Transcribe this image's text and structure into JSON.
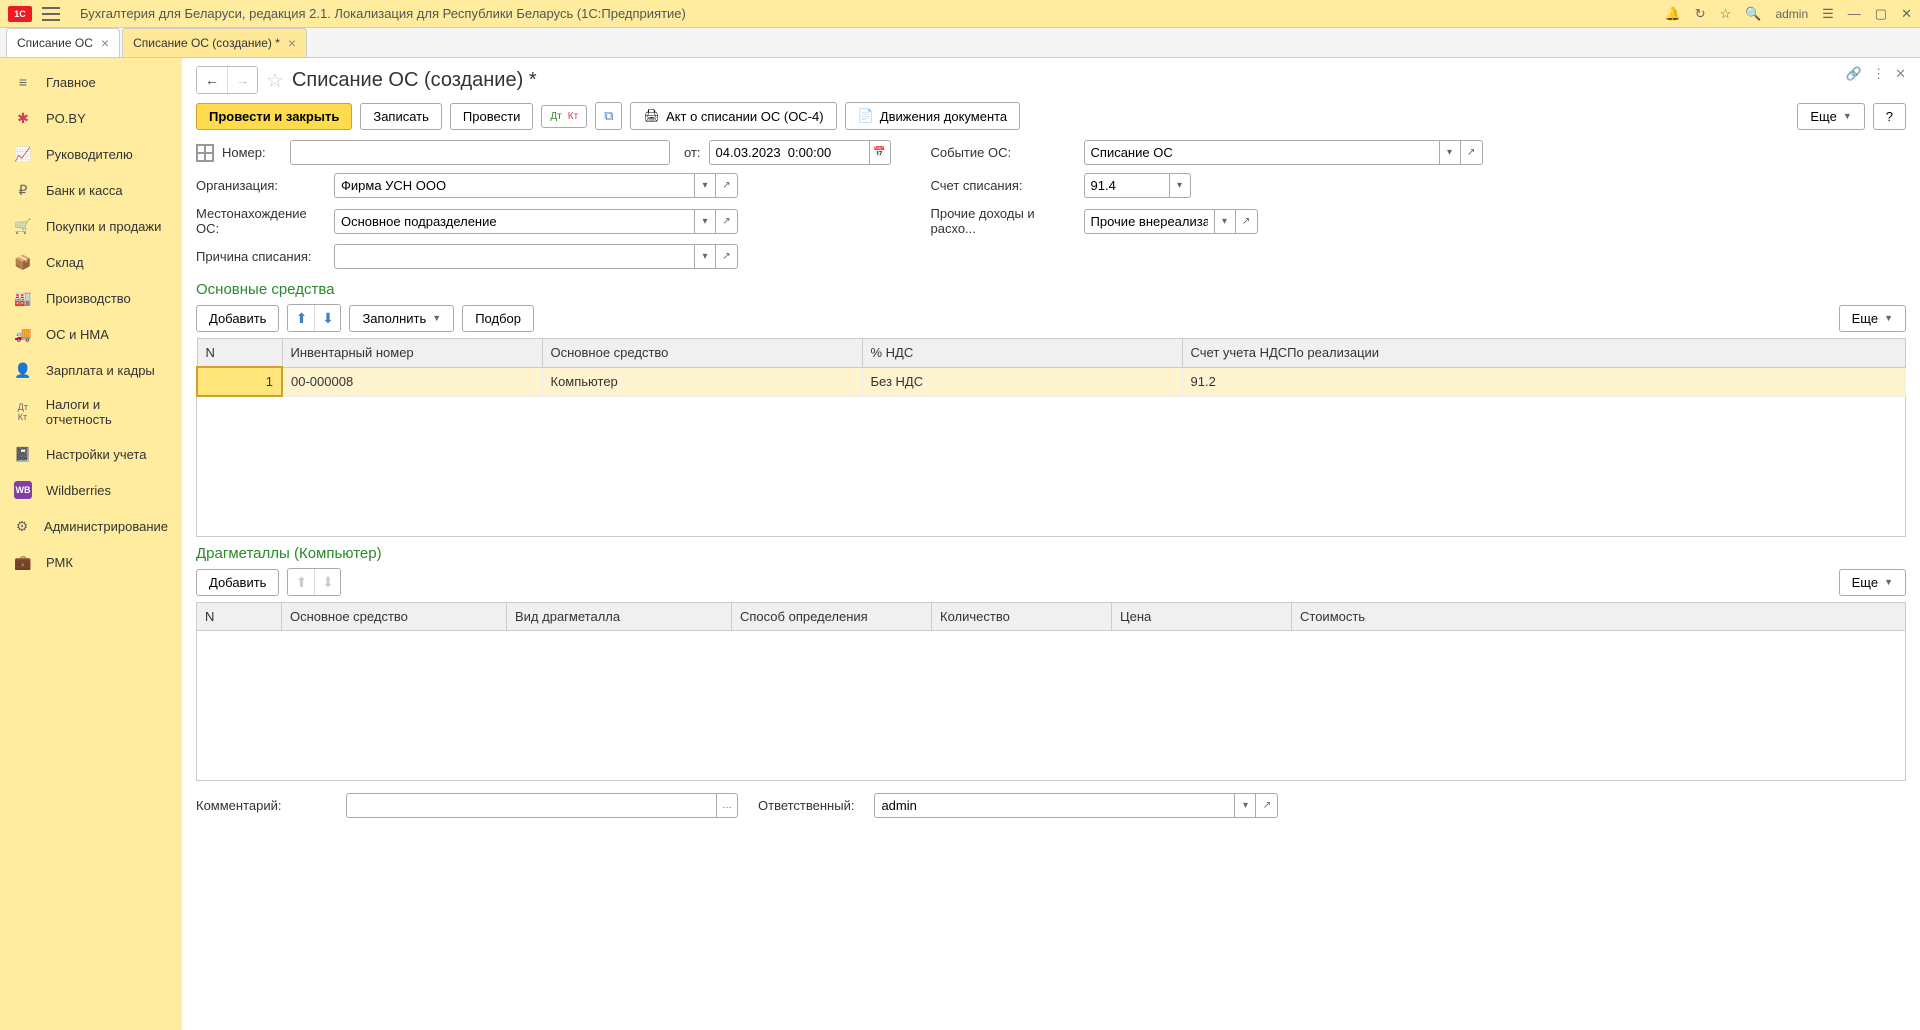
{
  "titlebar": {
    "app_title": "Бухгалтерия для Беларуси, редакция 2.1. Локализация для Республики Беларусь   (1С:Предприятие)",
    "user": "admin"
  },
  "tabs": [
    {
      "label": "Списание ОС",
      "active": false
    },
    {
      "label": "Списание ОС (создание) *",
      "active": true
    }
  ],
  "sidebar": [
    {
      "label": "Главное",
      "icon": "menu"
    },
    {
      "label": "PO.BY",
      "icon": "snowflake"
    },
    {
      "label": "Руководителю",
      "icon": "chart"
    },
    {
      "label": "Банк и касса",
      "icon": "ruble"
    },
    {
      "label": "Покупки и продажи",
      "icon": "cart"
    },
    {
      "label": "Склад",
      "icon": "box"
    },
    {
      "label": "Производство",
      "icon": "factory"
    },
    {
      "label": "ОС и НМА",
      "icon": "truck"
    },
    {
      "label": "Зарплата и кадры",
      "icon": "person"
    },
    {
      "label": "Налоги и отчетность",
      "icon": "dtkt"
    },
    {
      "label": "Настройки учета",
      "icon": "book"
    },
    {
      "label": "Wildberries",
      "icon": "wb"
    },
    {
      "label": "Администрирование",
      "icon": "gear"
    },
    {
      "label": "РМК",
      "icon": "briefcase"
    }
  ],
  "page": {
    "title": "Списание ОС (создание) *"
  },
  "toolbar": {
    "post_close": "Провести и закрыть",
    "record": "Записать",
    "post": "Провести",
    "print_act": "Акт о списании ОС (ОС-4)",
    "movements": "Движения документа",
    "more": "Еще",
    "help": "?"
  },
  "form": {
    "number_label": "Номер:",
    "number": "",
    "from_label": "от:",
    "date": "04.03.2023  0:00:00",
    "org_label": "Организация:",
    "org": "Фирма УСН ООО",
    "location_label": "Местонахождение ОС:",
    "location": "Основное подразделение",
    "reason_label": "Причина списания:",
    "reason": "",
    "event_label": "Событие ОС:",
    "event": "Списание ОС",
    "writeoff_acct_label": "Счет списания:",
    "writeoff_acct": "91.4",
    "other_income_label": "Прочие доходы и расхо...",
    "other_income": "Прочие внереализацио"
  },
  "section_os": {
    "title": "Основные средства",
    "add": "Добавить",
    "fill": "Заполнить",
    "pick": "Подбор",
    "more": "Еще",
    "columns": [
      "N",
      "Инвентарный номер",
      "Основное средство",
      "% НДС",
      "Счет учета НДСПо реализации"
    ],
    "rows": [
      {
        "n": "1",
        "inv": "00-000008",
        "name": "Компьютер",
        "vat": "Без НДС",
        "acct": "91.2"
      }
    ]
  },
  "section_metals": {
    "title": "Драгметаллы (Компьютер)",
    "add": "Добавить",
    "more": "Еще",
    "columns": [
      "N",
      "Основное средство",
      "Вид драгметалла",
      "Способ определения",
      "Количество",
      "Цена",
      "Стоимость"
    ]
  },
  "footer": {
    "comment_label": "Комментарий:",
    "comment": "",
    "responsible_label": "Ответственный:",
    "responsible": "admin"
  }
}
